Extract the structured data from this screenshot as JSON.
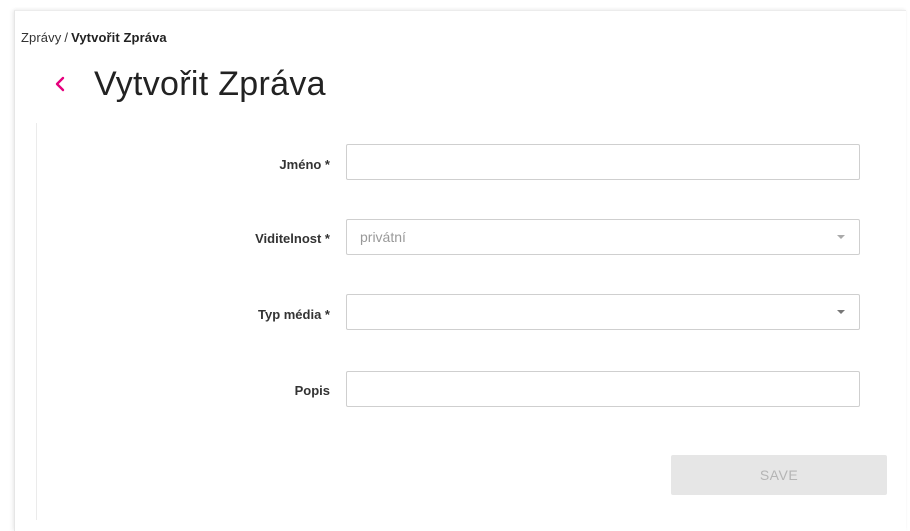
{
  "breadcrumb": {
    "parent": "Zprávy",
    "separator": "/",
    "current": "Vytvořit Zpráva"
  },
  "header": {
    "back_icon": "chevron-left-icon",
    "title": "Vytvořit Zpráva",
    "accent_color": "#e5007d"
  },
  "form": {
    "name": {
      "label": "Jméno *",
      "value": "",
      "placeholder": ""
    },
    "visibility": {
      "label": "Viditelnost *",
      "selected": "privátní",
      "disabled": true
    },
    "media_type": {
      "label": "Typ média *",
      "selected": ""
    },
    "description": {
      "label": "Popis",
      "value": "",
      "placeholder": ""
    },
    "save_label": "SAVE"
  }
}
